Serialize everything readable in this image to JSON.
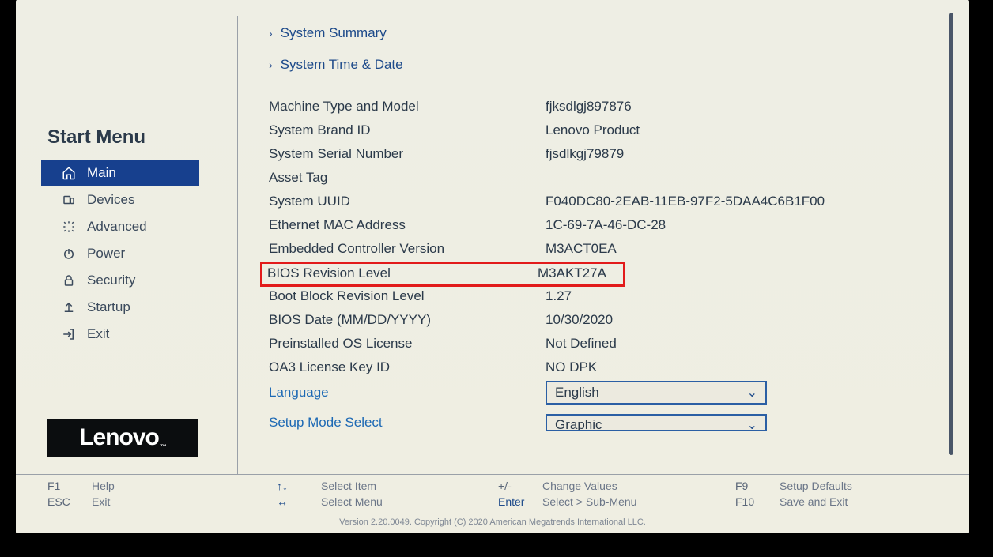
{
  "sidebar": {
    "title": "Start Menu",
    "items": [
      {
        "label": "Main"
      },
      {
        "label": "Devices"
      },
      {
        "label": "Advanced"
      },
      {
        "label": "Power"
      },
      {
        "label": "Security"
      },
      {
        "label": "Startup"
      },
      {
        "label": "Exit"
      }
    ]
  },
  "logo": "Lenovo",
  "submenus": {
    "summary": "System Summary",
    "timedate": "System Time & Date"
  },
  "fields": {
    "machine_type": {
      "label": "Machine Type and Model",
      "value": "fjksdlgj897876"
    },
    "brand_id": {
      "label": "System Brand ID",
      "value": "Lenovo Product"
    },
    "serial": {
      "label": "System Serial Number",
      "value": "fjsdlkgj79879"
    },
    "asset_tag": {
      "label": "Asset Tag",
      "value": ""
    },
    "uuid": {
      "label": "System UUID",
      "value": "F040DC80-2EAB-11EB-97F2-5DAA4C6B1F00"
    },
    "mac": {
      "label": "Ethernet MAC Address",
      "value": "1C-69-7A-46-DC-28"
    },
    "ec_ver": {
      "label": "Embedded Controller Version",
      "value": "M3ACT0EA"
    },
    "bios_rev": {
      "label": "BIOS Revision Level",
      "value": "M3AKT27A"
    },
    "boot_block": {
      "label": "Boot Block Revision Level",
      "value": "1.27"
    },
    "bios_date": {
      "label": "BIOS Date (MM/DD/YYYY)",
      "value": "10/30/2020"
    },
    "os_lic": {
      "label": "Preinstalled OS License",
      "value": "Not Defined"
    },
    "oa3": {
      "label": "OA3 License Key ID",
      "value": "NO DPK"
    },
    "language": {
      "label": "Language",
      "value": "English"
    },
    "setup_mode": {
      "label": "Setup Mode Select",
      "value": "Graphic"
    }
  },
  "footer": {
    "f1": {
      "key": "F1",
      "text": "Help"
    },
    "esc": {
      "key": "ESC",
      "text": "Exit"
    },
    "updn": {
      "key": "↑↓",
      "text": "Select Item"
    },
    "lr": {
      "key": "↔",
      "text": "Select Menu"
    },
    "pm": {
      "key": "+/-",
      "text": "Change Values"
    },
    "ent": {
      "key": "Enter",
      "text": "Select > Sub-Menu"
    },
    "f9": {
      "key": "F9",
      "text": "Setup Defaults"
    },
    "f10": {
      "key": "F10",
      "text": "Save and Exit"
    }
  },
  "copyright": "Version 2.20.0049. Copyright (C) 2020 American Megatrends International LLC."
}
